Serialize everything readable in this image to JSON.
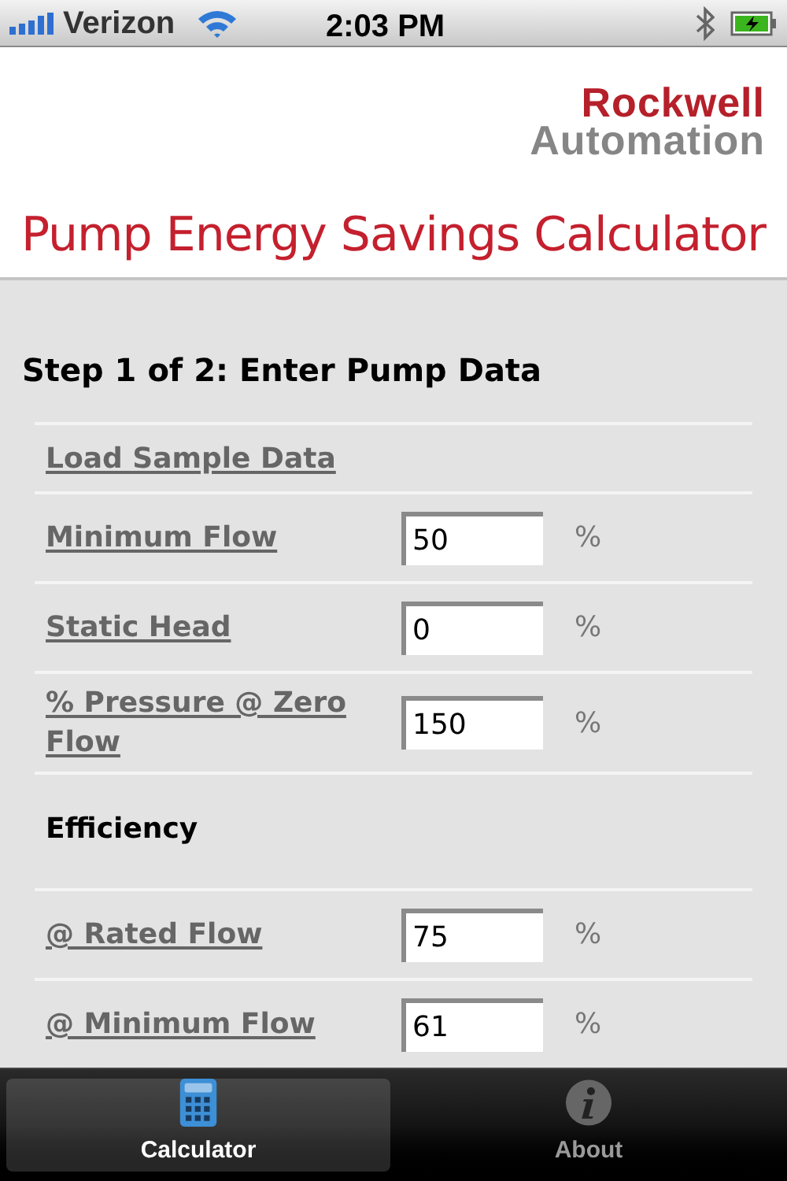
{
  "status_bar": {
    "carrier": "Verizon",
    "time": "2:03 PM"
  },
  "header": {
    "logo": {
      "line_1": "Rockwell",
      "line_2": "Automation"
    },
    "title": "Pump Energy Savings Calculator"
  },
  "step_heading": "Step 1 of 2: Enter Pump Data",
  "rows": [
    {
      "kind": "link",
      "label": "Load Sample Data"
    },
    {
      "kind": "field",
      "label": "Minimum Flow",
      "value": "50",
      "unit": "%"
    },
    {
      "kind": "field",
      "label": "Static Head",
      "value": "0",
      "unit": "%"
    },
    {
      "kind": "field",
      "label": "% Pressure @ Zero Flow",
      "value": "150",
      "unit": "%"
    },
    {
      "kind": "section",
      "label": "Efficiency"
    },
    {
      "kind": "field",
      "label": "@ Rated Flow",
      "value": "75",
      "unit": "%"
    },
    {
      "kind": "field",
      "label": "@ Minimum Flow",
      "value": "61",
      "unit": "%"
    }
  ],
  "tab_bar": [
    {
      "label": "Calculator",
      "kind": "calculator",
      "selected": true
    },
    {
      "label": "About",
      "kind": "info",
      "selected": false
    }
  ]
}
